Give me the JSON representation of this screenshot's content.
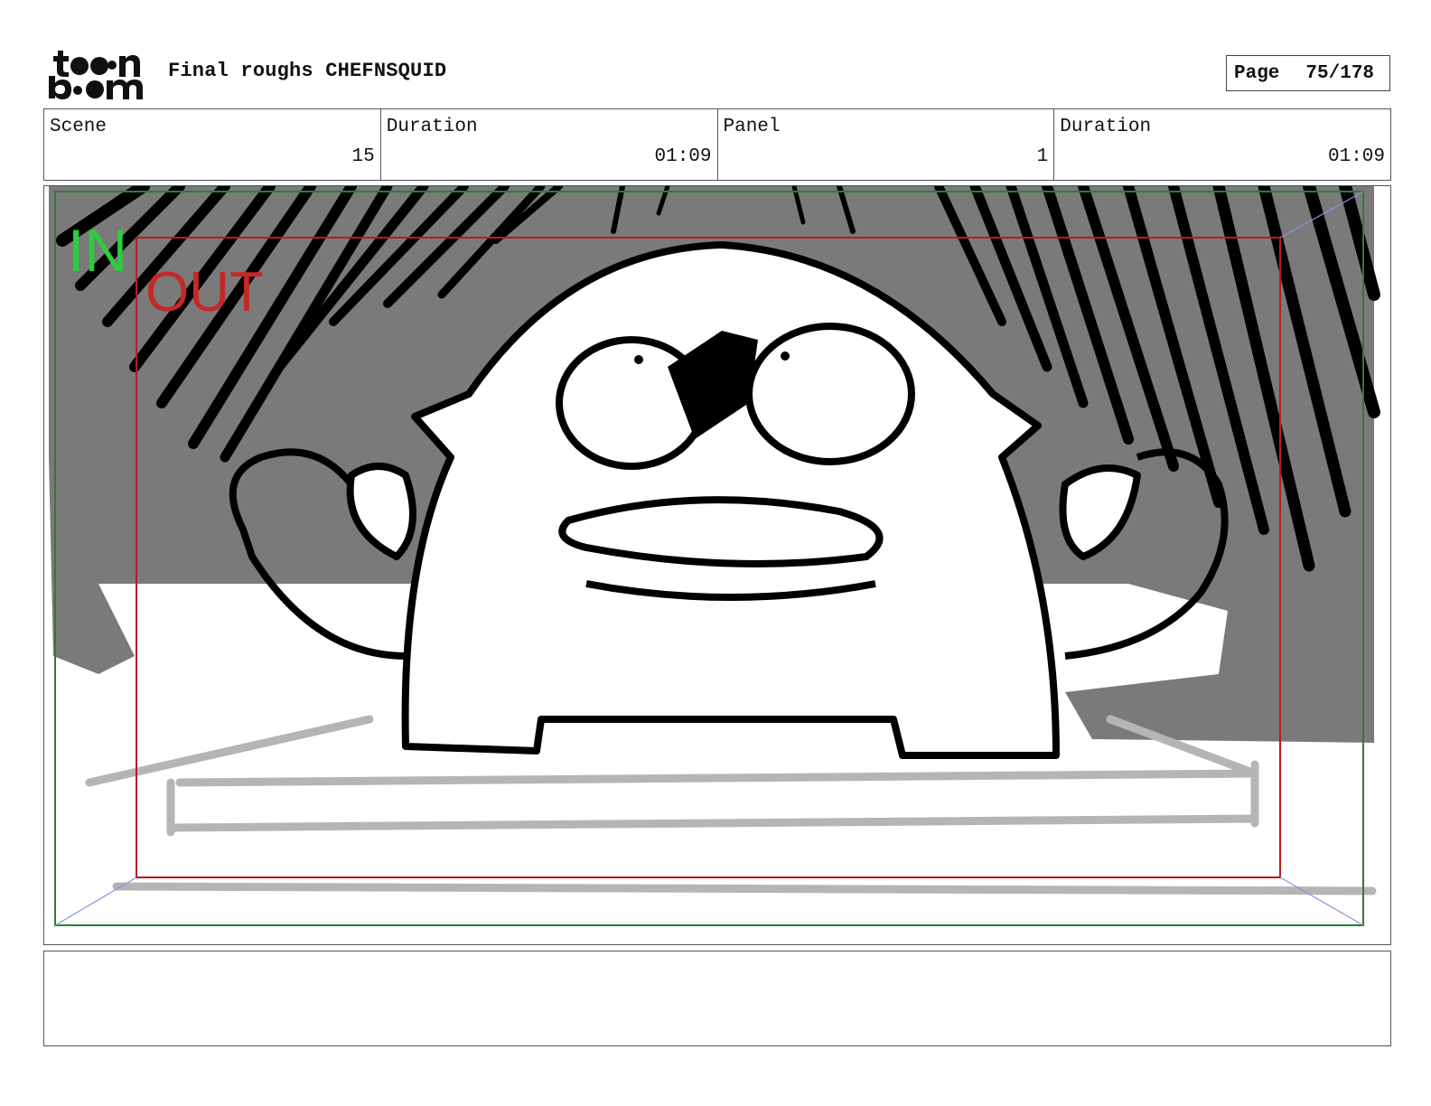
{
  "header": {
    "logo_text": "toon boom",
    "title": "Final roughs CHEFNSQUID",
    "page_label": "Page",
    "page_value": "75/178"
  },
  "info": [
    {
      "label": "Scene",
      "value": "15"
    },
    {
      "label": "Duration",
      "value": "01:09"
    },
    {
      "label": "Panel",
      "value": "1"
    },
    {
      "label": "Duration",
      "value": "01:09"
    }
  ],
  "panel": {
    "in_label": "IN",
    "out_label": "OUT",
    "colors": {
      "in_frame": "#2e7d32",
      "in_text": "#2ecc40",
      "out_frame": "#b71c1c",
      "out_text": "#c62828",
      "background_gray": "#7a7a7a",
      "sketch_gray": "#b5b5b5"
    }
  },
  "notes": {
    "text": ""
  }
}
